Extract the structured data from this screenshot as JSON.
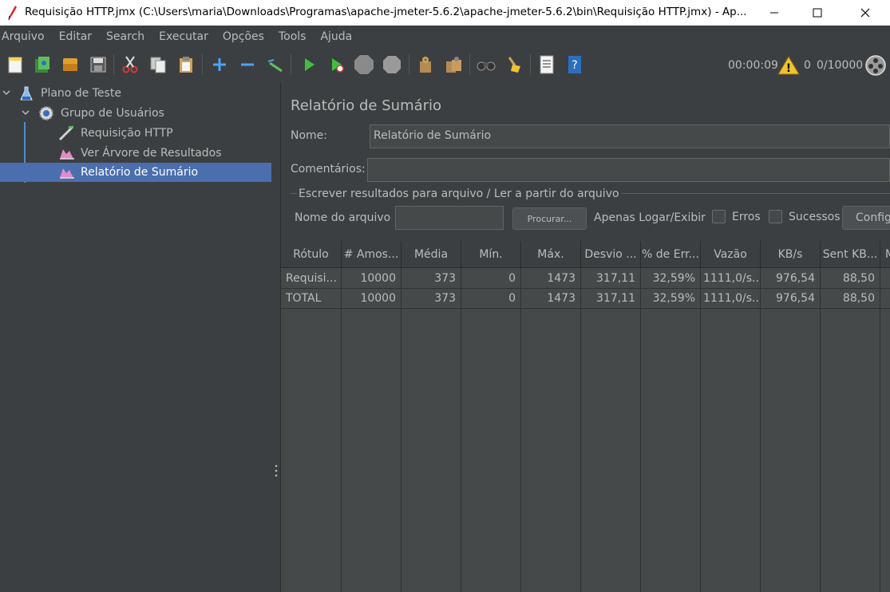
{
  "window": {
    "title": "Requisição HTTP.jmx (C:\\Users\\maria\\Downloads\\Programas\\apache-jmeter-5.6.2\\apache-jmeter-5.6.2\\bin\\Requisição HTTP.jmx) - Ap..."
  },
  "menu": [
    "Arquivo",
    "Editar",
    "Search",
    "Executar",
    "Opções",
    "Tools",
    "Ajuda"
  ],
  "toolbar": {
    "icons": [
      "new-icon",
      "templates-icon",
      "open-icon",
      "save-icon",
      "cut-icon",
      "copy-icon",
      "paste-icon",
      "expand-icon",
      "collapse-icon",
      "toggle-icon",
      "start-icon",
      "start-no-pauses-icon",
      "stop-icon",
      "shutdown-icon",
      "clear-icon",
      "clear-all-icon",
      "search-icon",
      "reset-search-icon",
      "function-helper-icon",
      "help-icon"
    ],
    "timer": "00:00:09",
    "warnings": "0",
    "threads": "0/10000",
    "accent": "#4b6eaf"
  },
  "tree": {
    "items": [
      {
        "label": "Plano de Teste",
        "icon": "test-plan-icon"
      },
      {
        "label": "Grupo de Usuários",
        "icon": "thread-group-icon"
      },
      {
        "label": "Requisição HTTP",
        "icon": "http-sampler-icon"
      },
      {
        "label": "Ver Árvore de Resultados",
        "icon": "listener-icon"
      },
      {
        "label": "Relatório de Sumário",
        "icon": "listener-icon"
      }
    ],
    "selected_index": 4
  },
  "panel": {
    "title": "Relatório de Sumário",
    "name_label": "Nome:",
    "name_value": "Relatório de Sumário",
    "comments_label": "Comentários:",
    "comments_value": "",
    "file_section_label": "Escrever resultados para arquivo / Ler a partir do arquivo",
    "filename_label": "Nome do arquivo",
    "filename_value": "",
    "browse_button": "Procurar...",
    "log_display_label": "Apenas Logar/Exibir",
    "errors_label": "Erros",
    "successes_label": "Sucessos",
    "configure_button": "Configurar"
  },
  "table": {
    "headers": [
      "Rótulo",
      "# Amos...",
      "Média",
      "Mín.",
      "Máx.",
      "Desvio ...",
      "% de Err...",
      "Vazão",
      "KB/s",
      "Sent KB...",
      "M"
    ],
    "rows": [
      [
        "Requisi...",
        "10000",
        "373",
        "0",
        "1473",
        "317,11",
        "32,59%",
        "1111,0/s...",
        "976,54",
        "88,50",
        ""
      ],
      [
        "TOTAL",
        "10000",
        "373",
        "0",
        "1473",
        "317,11",
        "32,59%",
        "1111,0/s...",
        "976,54",
        "88,50",
        ""
      ]
    ]
  }
}
